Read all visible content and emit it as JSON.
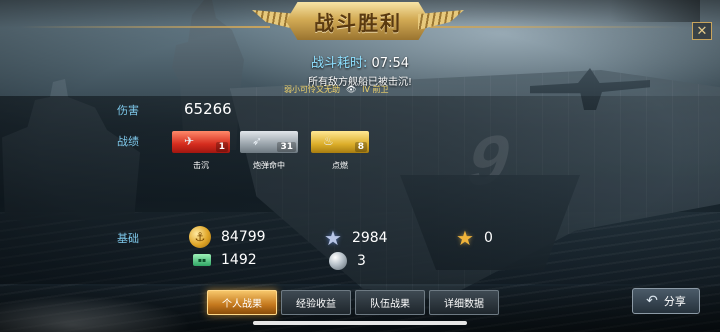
{
  "header": {
    "title": "战斗胜利",
    "close_glyph": "✕"
  },
  "summary": {
    "battle_time_label": "战斗耗时:",
    "battle_time_value": "07:54",
    "result_text": "所有敌方舰船已被击沉!",
    "player_name": "弱小可怜又无助",
    "player_rank": "IV 前卫"
  },
  "stats": {
    "damage_label": "伤害",
    "damage_value": "65266",
    "record_label": "战绩",
    "medals": [
      {
        "label": "击沉",
        "count": "1",
        "icon": "plane-sink-icon",
        "color": "#d52c1e"
      },
      {
        "label": "炮弹命中",
        "count": "31",
        "icon": "shell-hit-icon",
        "color": "#9aa4ab"
      },
      {
        "label": "点燃",
        "count": "8",
        "icon": "fire-icon",
        "color": "#dcae2a"
      }
    ],
    "base_label": "基础",
    "resources": [
      {
        "icon": "gold-coin-icon",
        "value": "84799"
      },
      {
        "icon": "silver-star-icon",
        "value": "2984"
      },
      {
        "icon": "gold-star-icon",
        "value": "0"
      },
      {
        "icon": "green-ticket-icon",
        "value": "1492"
      },
      {
        "icon": "silver-orb-icon",
        "value": "3"
      }
    ]
  },
  "tabs": [
    {
      "label": "个人战果",
      "active": true
    },
    {
      "label": "经验收益",
      "active": false
    },
    {
      "label": "队伍战果",
      "active": false
    },
    {
      "label": "详细数据",
      "active": false
    }
  ],
  "share": {
    "label": "分享"
  },
  "colors": {
    "accent_gold": "#c9a45c",
    "label_blue": "#7ec8ea",
    "active_tab": "#f6c66a"
  }
}
